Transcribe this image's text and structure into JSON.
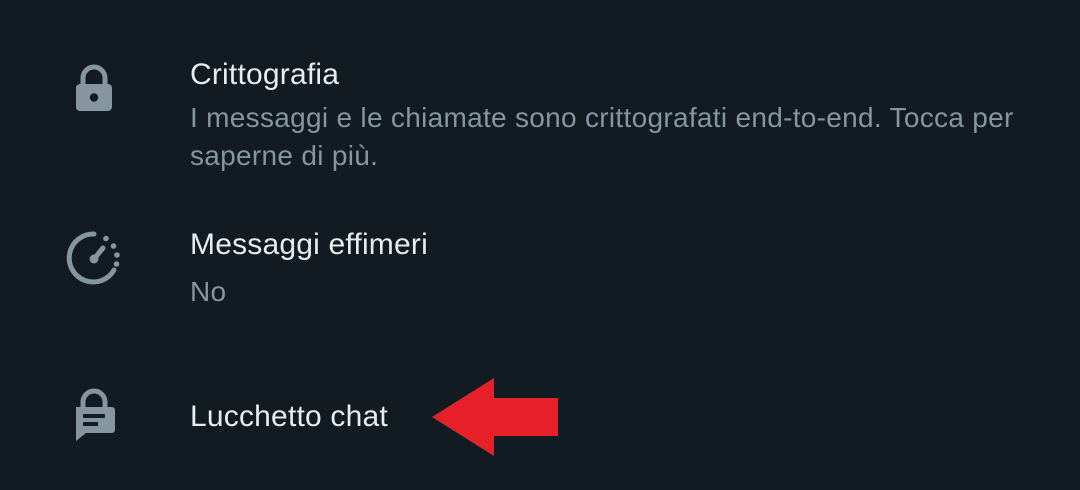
{
  "settings": {
    "encryption": {
      "icon": "lock-icon",
      "title": "Crittografia",
      "subtitle": "I messaggi e le chiamate sono crittografati end-to-end. Tocca per saperne di più."
    },
    "ephemeral": {
      "icon": "timer-icon",
      "title": "Messaggi effimeri",
      "subtitle": "No"
    },
    "chat_lock": {
      "icon": "chat-lock-icon",
      "title": "Lucchetto chat"
    }
  },
  "annotation": {
    "icon": "red-arrow-icon",
    "color": "#e8202a"
  },
  "colors": {
    "background": "#111b21",
    "title": "#e9edef",
    "subtitle": "#8696a0",
    "icon": "#8696a0"
  }
}
